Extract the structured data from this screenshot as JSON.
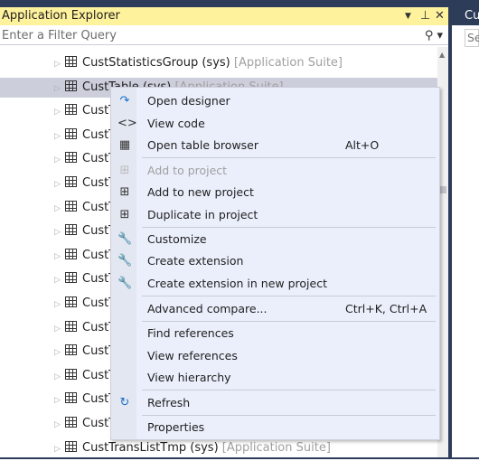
{
  "panel": {
    "title": "Application Explorer",
    "filter_placeholder": "Enter a Filter Query"
  },
  "right_panel": {
    "title": "Cu",
    "search": "Se"
  },
  "tree": [
    {
      "name": "CustStatisticsGroup",
      "owner": "(sys)",
      "model": "[Application Suite]"
    },
    {
      "name": "CustTable",
      "owner": "(sys)",
      "model": "[Application Suite]",
      "selected": true
    },
    {
      "name": "CustT"
    },
    {
      "name": "CustT"
    },
    {
      "name": "CustT"
    },
    {
      "name": "CustT"
    },
    {
      "name": "CustT"
    },
    {
      "name": "CustT"
    },
    {
      "name": "CustT"
    },
    {
      "name": "CustT"
    },
    {
      "name": "CustT"
    },
    {
      "name": "CustT"
    },
    {
      "name": "CustT"
    },
    {
      "name": "CustT"
    },
    {
      "name": "CustT"
    },
    {
      "name": "CustT"
    },
    {
      "name": "CustTransListTmp",
      "owner": "(sys)",
      "model": "[Application Suite]"
    }
  ],
  "menu": [
    {
      "label": "Open designer",
      "icon": "open-designer-icon",
      "glyph": "↷",
      "highlighted": true
    },
    {
      "label": "View code",
      "icon": "code-icon",
      "glyph": "<>"
    },
    {
      "label": "Open table browser",
      "icon": "table-icon",
      "glyph": "▦",
      "shortcut": "Alt+O"
    },
    {
      "label": "Add to project",
      "icon": "add-to-project-icon",
      "glyph": "⊞",
      "disabled": true
    },
    {
      "label": "Add to new project",
      "icon": "add-to-new-project-icon",
      "glyph": "⊞"
    },
    {
      "label": "Duplicate in project",
      "icon": "duplicate-icon",
      "glyph": "⊞"
    },
    {
      "label": "Customize",
      "icon": "wrench-icon",
      "glyph": "🔧"
    },
    {
      "label": "Create extension",
      "icon": "wrench-plus-icon",
      "glyph": "🔧"
    },
    {
      "label": "Create extension in new project",
      "icon": "wrench-plus-icon",
      "glyph": "🔧"
    },
    {
      "label": "Advanced compare...",
      "shortcut": "Ctrl+K, Ctrl+A"
    },
    {
      "label": "Find references"
    },
    {
      "label": "View references"
    },
    {
      "label": "View hierarchy"
    },
    {
      "label": "Refresh",
      "icon": "refresh-icon",
      "glyph": "↻"
    },
    {
      "label": "Properties"
    }
  ],
  "colors": {
    "title_bar": "#fff29d",
    "highlight_box": "#e8141a",
    "frame": "#2d3c59"
  }
}
